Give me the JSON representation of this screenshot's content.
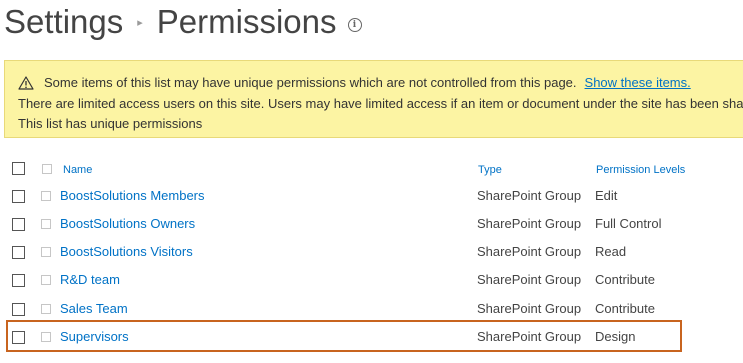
{
  "header": {
    "crumb_root": "Settings",
    "crumb_current": "Permissions",
    "info_glyph": "i"
  },
  "alert": {
    "line1": "Some items of this list may have unique permissions which are not controlled from this page.",
    "line1_link": "Show these items.",
    "line2": "There are limited access users on this site. Users may have limited access if an item or document under the site has been shared",
    "line3": "This list has unique permissions"
  },
  "columns": {
    "name": "Name",
    "type": "Type",
    "permission_levels": "Permission Levels"
  },
  "rows": [
    {
      "name": "BoostSolutions Members",
      "type": "SharePoint Group",
      "permission": "Edit"
    },
    {
      "name": "BoostSolutions Owners",
      "type": "SharePoint Group",
      "permission": "Full Control"
    },
    {
      "name": "BoostSolutions Visitors",
      "type": "SharePoint Group",
      "permission": "Read"
    },
    {
      "name": "R&D team",
      "type": "SharePoint Group",
      "permission": "Contribute"
    },
    {
      "name": "Sales Team",
      "type": "SharePoint Group",
      "permission": "Contribute"
    },
    {
      "name": "Supervisors",
      "type": "SharePoint Group",
      "permission": "Design"
    }
  ],
  "colors": {
    "link": "#0072c6",
    "alert_bg": "#fcf4a3",
    "highlight_border": "#c8641f"
  }
}
